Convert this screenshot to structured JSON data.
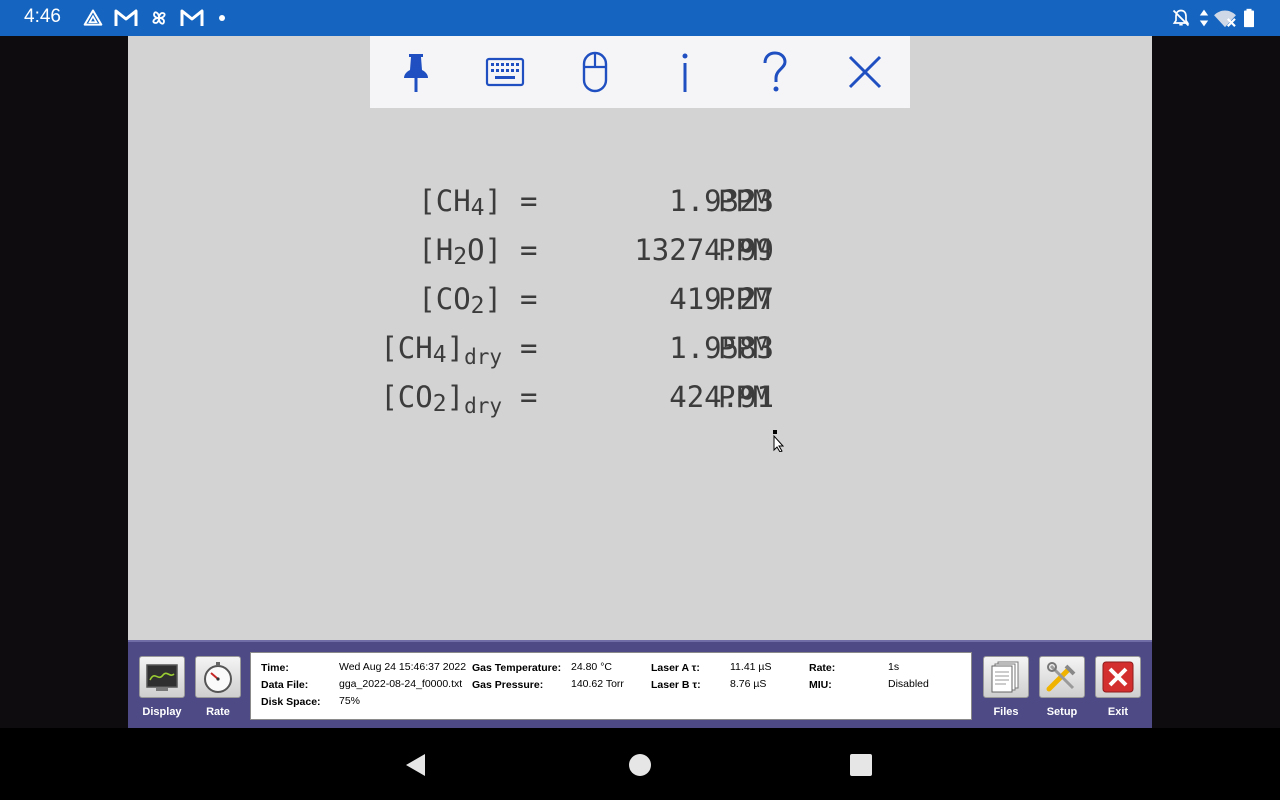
{
  "status_bar": {
    "time": "4:46",
    "left_icons": [
      "triangle-app-icon",
      "gmail-icon",
      "pinwheel-icon",
      "gmail-icon",
      "dot-icon"
    ],
    "right_icons": [
      "notifications-off-icon",
      "data-arrows-icon",
      "wifi-off-icon",
      "battery-icon"
    ]
  },
  "toolbar": {
    "buttons": [
      "pin-icon",
      "keyboard-icon",
      "mouse-icon",
      "info-icon",
      "help-icon",
      "close-icon"
    ]
  },
  "readings": [
    {
      "species": "[CH",
      "sub": "4",
      "close": "]",
      "suffix": "",
      "eq": "=",
      "value": "1.9323",
      "unit": "PPM"
    },
    {
      "species": "[H",
      "sub": "2",
      "close": "O]",
      "suffix": "",
      "eq": "=",
      "value": "13274.99",
      "unit": "PPM"
    },
    {
      "species": "[CO",
      "sub": "2",
      "close": "]",
      "suffix": "",
      "eq": "=",
      "value": "419.27",
      "unit": "PPM"
    },
    {
      "species": "[CH",
      "sub": "4",
      "close": "]",
      "suffix": "dry",
      "eq": "=",
      "value": "1.9583",
      "unit": "PPM"
    },
    {
      "species": "[CO",
      "sub": "2",
      "close": "]",
      "suffix": "dry",
      "eq": "=",
      "value": "424.91",
      "unit": "PPM"
    }
  ],
  "bottom_panel": {
    "display_label": "Display",
    "rate_label": "Rate",
    "files_label": "Files",
    "setup_label": "Setup",
    "exit_label": "Exit",
    "info": {
      "time_label": "Time:",
      "time_value": "Wed Aug 24 15:46:37 2022",
      "data_file_label": "Data File:",
      "data_file_value": "gga_2022-08-24_f0000.txt",
      "disk_space_label": "Disk Space:",
      "disk_space_value": "75%",
      "gas_temp_label": "Gas Temperature:",
      "gas_temp_value": "24.80 °C",
      "gas_pressure_label": "Gas Pressure:",
      "gas_pressure_value": "140.62 Torr",
      "laser_a_label": "Laser A τ:",
      "laser_a_value": "11.41 µS",
      "laser_b_label": "Laser B τ:",
      "laser_b_value": "8.76 µS",
      "rate_label": "Rate:",
      "rate_value": "1s",
      "miu_label": "MIU:",
      "miu_value": "Disabled"
    }
  },
  "nav_bar": {
    "buttons": [
      "back-icon",
      "home-icon",
      "recents-icon"
    ]
  },
  "colors": {
    "status_bar": "#1565c0",
    "toolbar_icon": "#1f4fc0",
    "app_background": "#d3d3d3",
    "bottom_panel": "#4d4a85"
  }
}
